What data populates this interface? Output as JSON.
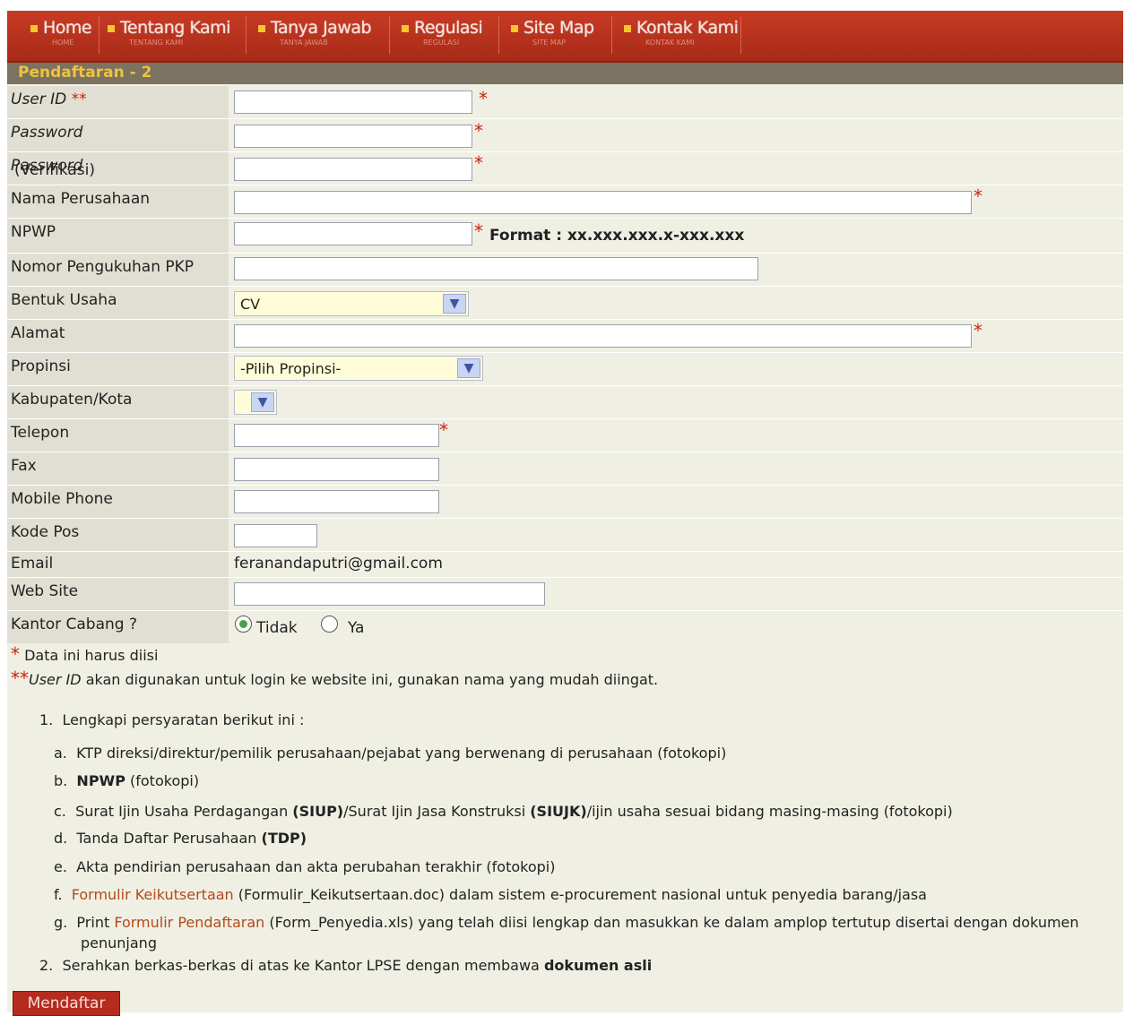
{
  "nav": {
    "items": [
      {
        "label": "Home",
        "sub": "HOME"
      },
      {
        "label": "Tentang Kami",
        "sub": "TENTANG KAMI"
      },
      {
        "label": "Tanya Jawab",
        "sub": "TANYA JAWAB"
      },
      {
        "label": "Regulasi",
        "sub": "REGULASI"
      },
      {
        "label": "Site Map",
        "sub": "SITE MAP"
      },
      {
        "label": "Kontak Kami",
        "sub": "KONTAK KAMI"
      }
    ]
  },
  "section_title": "Pendaftaran - 2",
  "form": {
    "user_id": {
      "label": "User ID",
      "value": ""
    },
    "password": {
      "label": "Password",
      "value": ""
    },
    "password_verif": {
      "label": "Password",
      "label_suffix": "(Verifikasi)",
      "value": ""
    },
    "nama_perusahaan": {
      "label": "Nama Perusahaan",
      "value": ""
    },
    "npwp": {
      "label": "NPWP",
      "value": "",
      "format": "Format : xx.xxx.xxx.x-xxx.xxx"
    },
    "pkp": {
      "label": "Nomor Pengukuhan PKP",
      "value": ""
    },
    "bentuk_usaha": {
      "label": "Bentuk Usaha",
      "selected": "CV"
    },
    "alamat": {
      "label": "Alamat",
      "value": ""
    },
    "propinsi": {
      "label": "Propinsi",
      "selected": "-Pilih Propinsi-"
    },
    "kabupaten": {
      "label": "Kabupaten/Kota",
      "selected": ""
    },
    "telepon": {
      "label": "Telepon",
      "value": ""
    },
    "fax": {
      "label": "Fax",
      "value": ""
    },
    "mobile": {
      "label": "Mobile Phone",
      "value": ""
    },
    "kode_pos": {
      "label": "Kode Pos",
      "value": ""
    },
    "email": {
      "label": "Email",
      "value": "feranandaputri@gmail.com"
    },
    "website": {
      "label": "Web Site",
      "value": ""
    },
    "kantor_cabang": {
      "label": "Kantor Cabang ?",
      "option_no": "Tidak",
      "option_yes": "Ya",
      "selected": "Tidak"
    }
  },
  "notes": {
    "required": "Data ini harus diisi",
    "userid_prefix": "User ID",
    "userid_note": "akan digunakan untuk login ke website ini, gunakan nama yang mudah diingat."
  },
  "requirements": {
    "intro_num": "1.",
    "intro": "Lengkapi persyaratan berikut ini :",
    "a": {
      "mark": "a.",
      "text": "KTP direksi/direktur/pemilik perusahaan/pejabat yang berwenang di perusahaan (fotokopi)"
    },
    "b": {
      "mark": "b.",
      "bold": "NPWP",
      "text": "(fotokopi)"
    },
    "c": {
      "mark": "c.",
      "t1": "Surat Ijin Usaha Perdagangan",
      "b1": "(SIUP)",
      "t2": "/Surat Ijin Jasa Konstruksi",
      "b2": "(SIUJK)",
      "t3": "/ijin usaha sesuai bidang masing-masing (fotokopi)"
    },
    "d": {
      "mark": "d.",
      "text": "Tanda Daftar Perusahaan",
      "bold": "(TDP)"
    },
    "e": {
      "mark": "e.",
      "text": "Akta pendirian perusahaan dan akta perubahan terakhir (fotokopi)"
    },
    "f": {
      "mark": "f.",
      "link": "Formulir Keikutsertaan",
      "text": "(Formulir_Keikutsertaan.doc) dalam sistem e-procurement nasional untuk penyedia barang/jasa"
    },
    "g": {
      "mark": "g.",
      "pre": "Print",
      "link": "Formulir Pendaftaran",
      "text": "(Form_Penyedia.xls) yang telah diisi lengkap dan masukkan ke dalam amplop tertutup disertai dengan dokumen",
      "text2": "penunjang"
    },
    "two_num": "2.",
    "two": "Serahkan berkas-berkas di atas ke Kantor LPSE dengan membawa",
    "two_bold": "dokumen asli"
  },
  "submit_label": "Mendaftar"
}
